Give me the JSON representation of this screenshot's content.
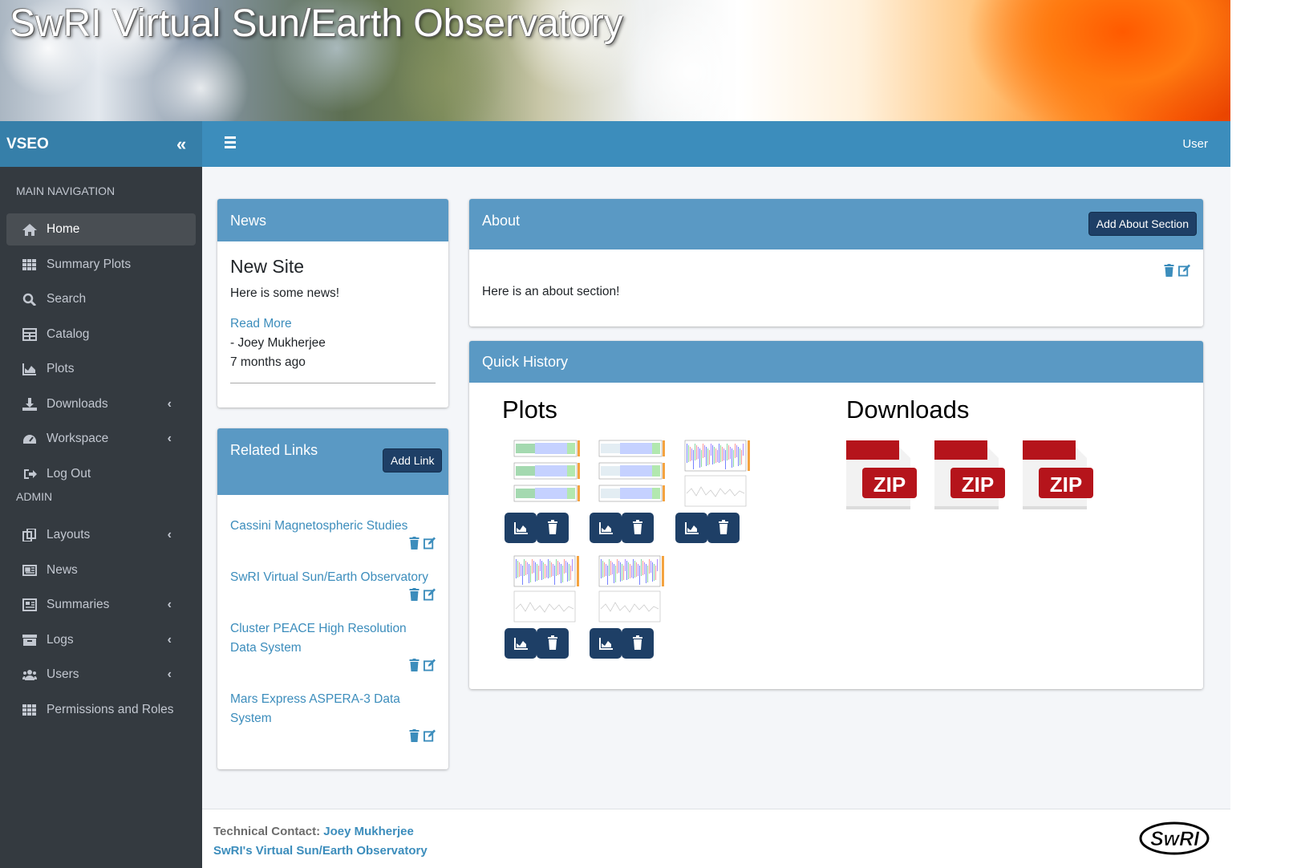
{
  "banner": {
    "title": "SwRI Virtual Sun/Earth Observatory"
  },
  "topbar": {
    "brand": "VSEO",
    "user": "User"
  },
  "sidebar": {
    "main_header": "MAIN NAVIGATION",
    "admin_header": "ADMIN",
    "main_items": [
      {
        "label": "Home",
        "icon": "home-icon",
        "active": true,
        "caret": false
      },
      {
        "label": "Summary Plots",
        "icon": "grid-icon",
        "caret": false
      },
      {
        "label": "Search",
        "icon": "search-icon",
        "caret": false
      },
      {
        "label": "Catalog",
        "icon": "table-icon",
        "caret": false
      },
      {
        "label": "Plots",
        "icon": "area-chart-icon",
        "caret": false
      },
      {
        "label": "Downloads",
        "icon": "download-icon",
        "caret": true
      },
      {
        "label": "Workspace",
        "icon": "dashboard-icon",
        "caret": true
      },
      {
        "label": "Log Out",
        "icon": "sign-out-icon",
        "caret": false
      }
    ],
    "admin_items": [
      {
        "label": "Layouts",
        "icon": "copy-icon",
        "caret": true
      },
      {
        "label": "News",
        "icon": "newspaper-icon",
        "caret": false
      },
      {
        "label": "Summaries",
        "icon": "summary-icon",
        "caret": true
      },
      {
        "label": "Logs",
        "icon": "archive-icon",
        "caret": true
      },
      {
        "label": "Users",
        "icon": "users-icon",
        "caret": true
      },
      {
        "label": "Permissions and Roles",
        "icon": "grid-icon",
        "caret": false
      }
    ]
  },
  "news": {
    "header": "News",
    "title": "New Site",
    "body": "Here is some news!",
    "read_more": "Read More",
    "author": "- Joey Mukherjee",
    "time": "7 months ago"
  },
  "links": {
    "header": "Related Links",
    "add_button": "Add Link",
    "items": [
      {
        "label": "Cassini Magnetospheric Studies"
      },
      {
        "label": "SwRI Virtual Sun/Earth Observatory"
      },
      {
        "label": "Cluster PEACE High Resolution Data System"
      },
      {
        "label": "Mars Express ASPERA-3 Data System"
      }
    ]
  },
  "about": {
    "header": "About",
    "add_button": "Add About Section",
    "body": "Here is an about section!"
  },
  "history": {
    "header": "Quick History",
    "plots_title": "Plots",
    "downloads_title": "Downloads",
    "zip_label": "ZIP",
    "plot_count": 5,
    "download_count": 3
  },
  "footer": {
    "contact_label": "Technical Contact:",
    "contact_name": "Joey Mukherjee",
    "site_link": "SwRI's Virtual Sun/Earth Observatory",
    "logo_text": "SwRI"
  },
  "colors": {
    "primary": "#3c8dbc",
    "card_header": "#5a99c4",
    "button_dark": "#1e3f66",
    "sidebar": "#343a40",
    "zip_red": "#b5141b"
  }
}
